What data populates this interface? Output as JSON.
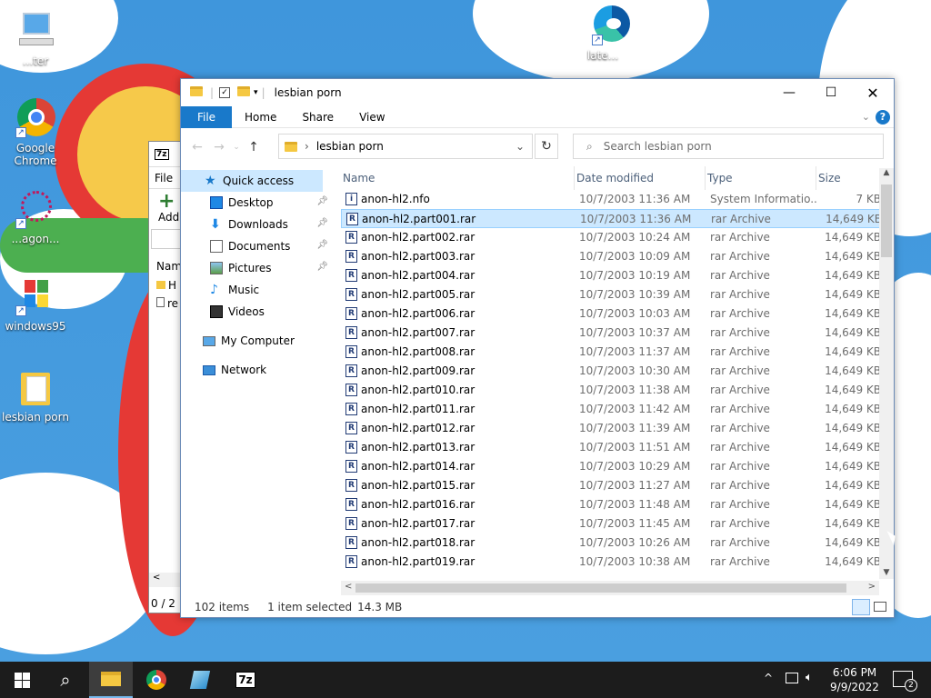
{
  "desktop": {
    "icons": [
      {
        "label": "...ter",
        "name": "computer"
      },
      {
        "label": "Google Chrome",
        "name": "chrome"
      },
      {
        "label": "...agon...",
        "name": "app"
      },
      {
        "label": "windows95",
        "name": "windows95"
      },
      {
        "label": "lesbian porn",
        "name": "folder"
      },
      {
        "label": "late...",
        "name": "edge"
      }
    ]
  },
  "window7z": {
    "title_icon": "7z",
    "menu": "File",
    "add_label": "Add",
    "col": "Nam",
    "rows": [
      "H",
      "re"
    ],
    "status": "0 / 2 o"
  },
  "explorer": {
    "title": "lesbian porn",
    "tabs": {
      "file": "File",
      "home": "Home",
      "share": "Share",
      "view": "View"
    },
    "address": "lesbian porn",
    "search_placeholder": "Search lesbian porn",
    "nav": {
      "quick_access": "Quick access",
      "desktop": "Desktop",
      "downloads": "Downloads",
      "documents": "Documents",
      "pictures": "Pictures",
      "music": "Music",
      "videos": "Videos",
      "my_computer": "My Computer",
      "network": "Network"
    },
    "columns": {
      "name": "Name",
      "date": "Date modified",
      "type": "Type",
      "size": "Size"
    },
    "files": [
      {
        "name": "anon-hl2.nfo",
        "date": "10/7/2003 11:36 AM",
        "type": "System Informatio...",
        "size": "7 KB"
      },
      {
        "name": "anon-hl2.part001.rar",
        "date": "10/7/2003 11:36 AM",
        "type": "rar Archive",
        "size": "14,649 KB"
      },
      {
        "name": "anon-hl2.part002.rar",
        "date": "10/7/2003 10:24 AM",
        "type": "rar Archive",
        "size": "14,649 KB"
      },
      {
        "name": "anon-hl2.part003.rar",
        "date": "10/7/2003 10:09 AM",
        "type": "rar Archive",
        "size": "14,649 KB"
      },
      {
        "name": "anon-hl2.part004.rar",
        "date": "10/7/2003 10:19 AM",
        "type": "rar Archive",
        "size": "14,649 KB"
      },
      {
        "name": "anon-hl2.part005.rar",
        "date": "10/7/2003 10:39 AM",
        "type": "rar Archive",
        "size": "14,649 KB"
      },
      {
        "name": "anon-hl2.part006.rar",
        "date": "10/7/2003 10:03 AM",
        "type": "rar Archive",
        "size": "14,649 KB"
      },
      {
        "name": "anon-hl2.part007.rar",
        "date": "10/7/2003 10:37 AM",
        "type": "rar Archive",
        "size": "14,649 KB"
      },
      {
        "name": "anon-hl2.part008.rar",
        "date": "10/7/2003 11:37 AM",
        "type": "rar Archive",
        "size": "14,649 KB"
      },
      {
        "name": "anon-hl2.part009.rar",
        "date": "10/7/2003 10:30 AM",
        "type": "rar Archive",
        "size": "14,649 KB"
      },
      {
        "name": "anon-hl2.part010.rar",
        "date": "10/7/2003 11:38 AM",
        "type": "rar Archive",
        "size": "14,649 KB"
      },
      {
        "name": "anon-hl2.part011.rar",
        "date": "10/7/2003 11:42 AM",
        "type": "rar Archive",
        "size": "14,649 KB"
      },
      {
        "name": "anon-hl2.part012.rar",
        "date": "10/7/2003 11:39 AM",
        "type": "rar Archive",
        "size": "14,649 KB"
      },
      {
        "name": "anon-hl2.part013.rar",
        "date": "10/7/2003 11:51 AM",
        "type": "rar Archive",
        "size": "14,649 KB"
      },
      {
        "name": "anon-hl2.part014.rar",
        "date": "10/7/2003 10:29 AM",
        "type": "rar Archive",
        "size": "14,649 KB"
      },
      {
        "name": "anon-hl2.part015.rar",
        "date": "10/7/2003 11:27 AM",
        "type": "rar Archive",
        "size": "14,649 KB"
      },
      {
        "name": "anon-hl2.part016.rar",
        "date": "10/7/2003 11:48 AM",
        "type": "rar Archive",
        "size": "14,649 KB"
      },
      {
        "name": "anon-hl2.part017.rar",
        "date": "10/7/2003 11:45 AM",
        "type": "rar Archive",
        "size": "14,649 KB"
      },
      {
        "name": "anon-hl2.part018.rar",
        "date": "10/7/2003 10:26 AM",
        "type": "rar Archive",
        "size": "14,649 KB"
      },
      {
        "name": "anon-hl2.part019.rar",
        "date": "10/7/2003 10:38 AM",
        "type": "rar Archive",
        "size": "14,649 KB"
      }
    ],
    "selected_index": 1,
    "status": {
      "count": "102 items",
      "selected": "1 item selected",
      "size": "14.3 MB"
    }
  },
  "taskbar": {
    "time": "6:06 PM",
    "date": "9/9/2022",
    "notifications": "2",
    "app_7z": "7z"
  },
  "colors": {
    "accent": "#1979ca",
    "selection": "#cce8ff",
    "taskbar": "#1c1c1c"
  }
}
